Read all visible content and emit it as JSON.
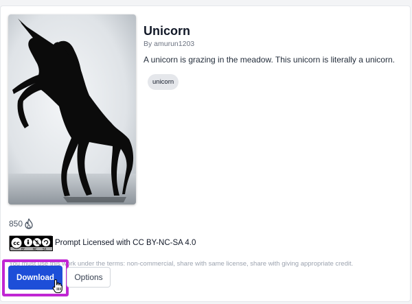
{
  "card": {
    "image_alt": "unicorn-silhouette",
    "title": "Unicorn",
    "author": "By amurun1203",
    "description": "A unicorn is grazing in the meadow. This unicorn is literally a unicorn.",
    "tags": [
      "unicorn"
    ]
  },
  "stats": {
    "likes": "850",
    "likes_icon": "flame-icon"
  },
  "license": {
    "badge_icon": "cc-by-nc-sa-badge",
    "text": "Prompt Licensed with CC BY-NC-SA 4.0",
    "terms": "You must use this work under the terms: non-commercial, share with same license, share with giving appropriate credit."
  },
  "actions": {
    "download_label": "Download",
    "options_label": "Options"
  },
  "colors": {
    "accent": "#1d4ed8",
    "highlight": "#c026d3"
  }
}
